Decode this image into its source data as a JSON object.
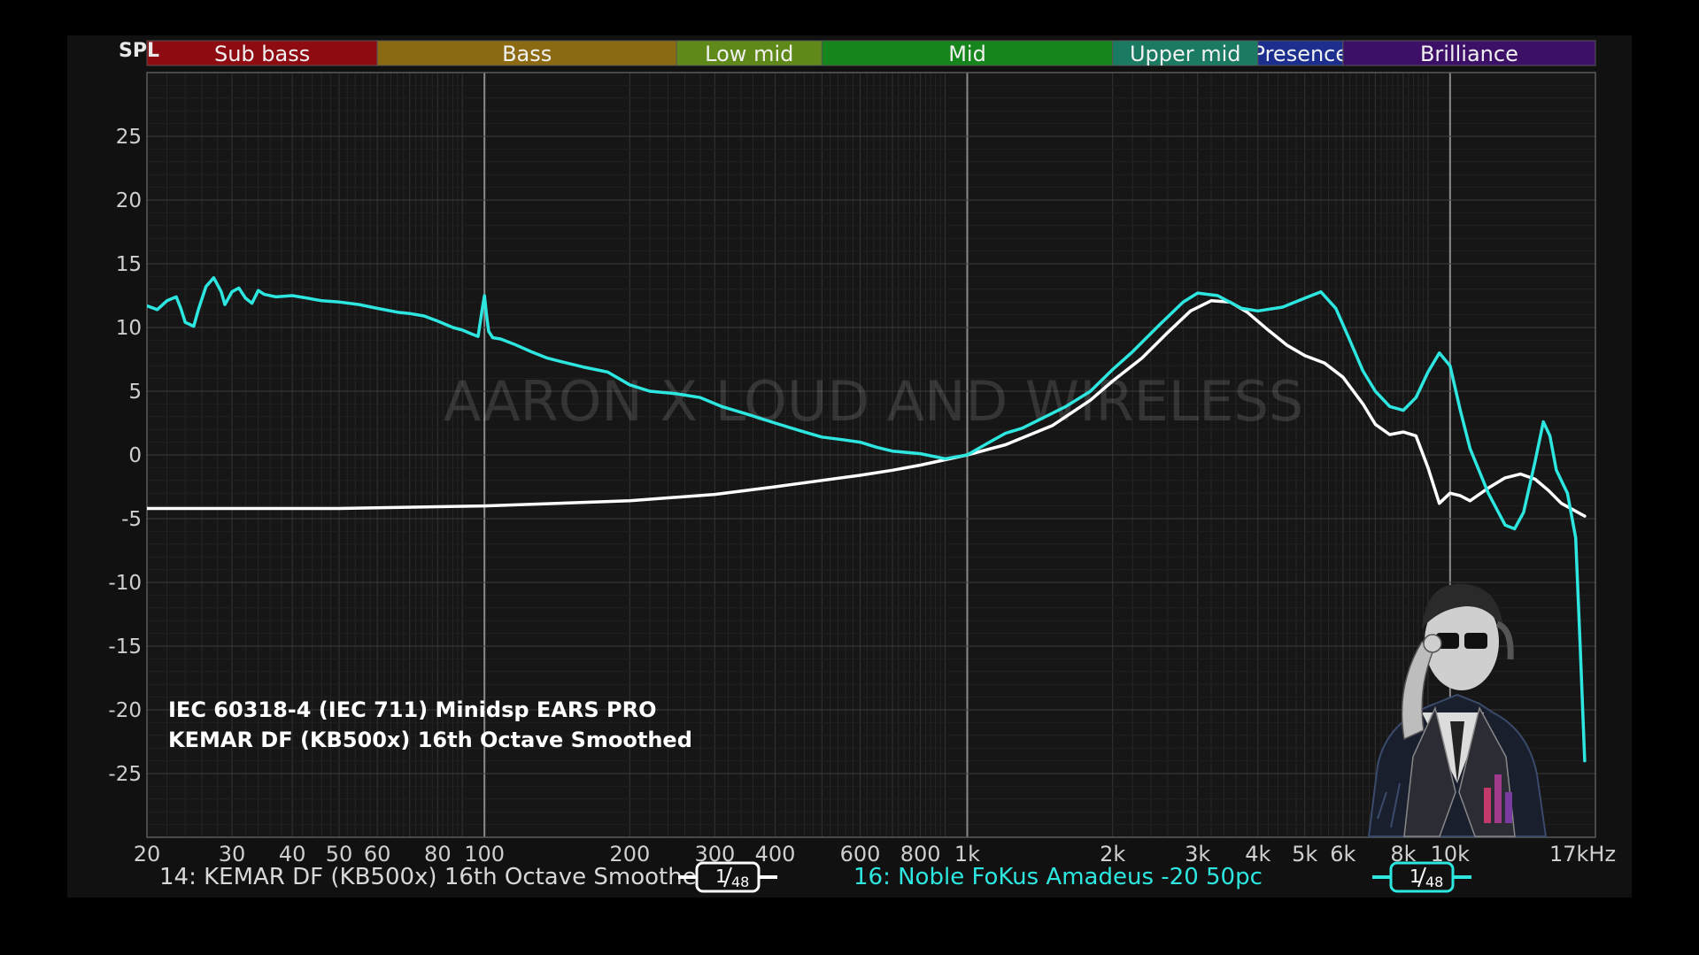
{
  "axis": {
    "y_label": "SPL",
    "x_unit_label": "kHz"
  },
  "bands": [
    {
      "label": "Sub bass",
      "from": 20,
      "to": 60,
      "color": "#8e0b12"
    },
    {
      "label": "Bass",
      "from": 60,
      "to": 250,
      "color": "#8c6a12"
    },
    {
      "label": "Low mid",
      "from": 250,
      "to": 500,
      "color": "#5f8a1a"
    },
    {
      "label": "Mid",
      "from": 500,
      "to": 2000,
      "color": "#15851c"
    },
    {
      "label": "Upper mid",
      "from": 2000,
      "to": 4000,
      "color": "#1a7a62"
    },
    {
      "label": "Presence",
      "from": 4000,
      "to": 6000,
      "color": "#1c2f8e"
    },
    {
      "label": "Brilliance",
      "from": 6000,
      "to": 20000,
      "color": "#3d1068"
    }
  ],
  "watermark": "AARON X LOUD AND WIRELESS",
  "notes": [
    "IEC 60318-4 (IEC 711) Minidsp EARS PRO",
    "KEMAR DF (KB500x) 16th Octave Smoothed"
  ],
  "legend": [
    {
      "label": "14: KEMAR DF (KB500x) 16th Octave Smoothed",
      "color": "#ffffff",
      "smoothing_num": "1",
      "smoothing_den": "48"
    },
    {
      "label": "16: Noble FoKus Amadeus -20 50pc",
      "color": "#2ee6e0",
      "smoothing_num": "1",
      "smoothing_den": "48"
    }
  ],
  "chart_data": {
    "type": "line",
    "xscale": "log",
    "xlim": [
      20,
      20000
    ],
    "ylim": [
      -30,
      30
    ],
    "grid": true,
    "xlabel": "",
    "ylabel": "SPL",
    "x_ticks": [
      {
        "v": 20,
        "t": "20"
      },
      {
        "v": 30,
        "t": "30"
      },
      {
        "v": 40,
        "t": "40"
      },
      {
        "v": 50,
        "t": "50"
      },
      {
        "v": 60,
        "t": "60"
      },
      {
        "v": 80,
        "t": "80"
      },
      {
        "v": 100,
        "t": "100"
      },
      {
        "v": 200,
        "t": "200"
      },
      {
        "v": 300,
        "t": "300"
      },
      {
        "v": 400,
        "t": "400"
      },
      {
        "v": 600,
        "t": "600"
      },
      {
        "v": 800,
        "t": "800"
      },
      {
        "v": 1000,
        "t": "1k"
      },
      {
        "v": 2000,
        "t": "2k"
      },
      {
        "v": 3000,
        "t": "3k"
      },
      {
        "v": 4000,
        "t": "4k"
      },
      {
        "v": 5000,
        "t": "5k"
      },
      {
        "v": 6000,
        "t": "6k"
      },
      {
        "v": 8000,
        "t": "8k"
      },
      {
        "v": 10000,
        "t": "10k"
      },
      {
        "v": 17000,
        "t": "17kHz"
      }
    ],
    "y_ticks": [
      {
        "v": 25,
        "t": "25"
      },
      {
        "v": 20,
        "t": "20"
      },
      {
        "v": 15,
        "t": "15"
      },
      {
        "v": 10,
        "t": "10"
      },
      {
        "v": 5,
        "t": "5"
      },
      {
        "v": 0,
        "t": "0"
      },
      {
        "v": -5,
        "t": "-5"
      },
      {
        "v": -10,
        "t": "-10"
      },
      {
        "v": -15,
        "t": "-15"
      },
      {
        "v": -20,
        "t": "-20"
      },
      {
        "v": -25,
        "t": "-25"
      }
    ],
    "series": [
      {
        "name": "14: KEMAR DF (KB500x) 16th Octave Smoothed",
        "color": "#ffffff",
        "points": [
          [
            20,
            -4.2
          ],
          [
            50,
            -4.2
          ],
          [
            100,
            -4.0
          ],
          [
            200,
            -3.6
          ],
          [
            300,
            -3.1
          ],
          [
            400,
            -2.5
          ],
          [
            500,
            -2.0
          ],
          [
            600,
            -1.6
          ],
          [
            700,
            -1.2
          ],
          [
            800,
            -0.8
          ],
          [
            1000,
            0.0
          ],
          [
            1200,
            0.8
          ],
          [
            1500,
            2.3
          ],
          [
            1800,
            4.3
          ],
          [
            2000,
            5.8
          ],
          [
            2300,
            7.6
          ],
          [
            2600,
            9.6
          ],
          [
            2900,
            11.3
          ],
          [
            3200,
            12.1
          ],
          [
            3500,
            12.0
          ],
          [
            3800,
            11.2
          ],
          [
            4200,
            9.8
          ],
          [
            4600,
            8.6
          ],
          [
            5000,
            7.8
          ],
          [
            5500,
            7.2
          ],
          [
            6000,
            6.1
          ],
          [
            6600,
            4.0
          ],
          [
            7000,
            2.4
          ],
          [
            7500,
            1.6
          ],
          [
            8000,
            1.8
          ],
          [
            8500,
            1.5
          ],
          [
            9000,
            -1.0
          ],
          [
            9500,
            -3.8
          ],
          [
            10000,
            -3.0
          ],
          [
            10500,
            -3.2
          ],
          [
            11000,
            -3.6
          ],
          [
            12000,
            -2.6
          ],
          [
            13000,
            -1.8
          ],
          [
            14000,
            -1.5
          ],
          [
            15000,
            -1.9
          ],
          [
            16000,
            -2.8
          ],
          [
            17000,
            -3.8
          ],
          [
            19000,
            -4.8
          ]
        ]
      },
      {
        "name": "16: Noble FoKus Amadeus -20 50pc",
        "color": "#2ee6e0",
        "points": [
          [
            20,
            11.7
          ],
          [
            21,
            11.4
          ],
          [
            22,
            12.1
          ],
          [
            23,
            12.4
          ],
          [
            23.5,
            11.5
          ],
          [
            24,
            10.4
          ],
          [
            25,
            10.1
          ],
          [
            25.6,
            11.5
          ],
          [
            26.5,
            13.2
          ],
          [
            27.5,
            13.9
          ],
          [
            28.5,
            12.8
          ],
          [
            29,
            11.8
          ],
          [
            30,
            12.8
          ],
          [
            31,
            13.1
          ],
          [
            32,
            12.3
          ],
          [
            33,
            11.9
          ],
          [
            34,
            12.9
          ],
          [
            35,
            12.6
          ],
          [
            37,
            12.4
          ],
          [
            40,
            12.5
          ],
          [
            43,
            12.3
          ],
          [
            46,
            12.1
          ],
          [
            50,
            12.0
          ],
          [
            55,
            11.8
          ],
          [
            60,
            11.5
          ],
          [
            66,
            11.2
          ],
          [
            70,
            11.1
          ],
          [
            75,
            10.9
          ],
          [
            80,
            10.5
          ],
          [
            86,
            10.0
          ],
          [
            90,
            9.8
          ],
          [
            94,
            9.5
          ],
          [
            97,
            9.3
          ],
          [
            99,
            11.5
          ],
          [
            100,
            12.5
          ],
          [
            101,
            11.0
          ],
          [
            102,
            9.7
          ],
          [
            104,
            9.2
          ],
          [
            108,
            9.1
          ],
          [
            115,
            8.7
          ],
          [
            125,
            8.1
          ],
          [
            135,
            7.6
          ],
          [
            145,
            7.3
          ],
          [
            160,
            6.9
          ],
          [
            180,
            6.5
          ],
          [
            200,
            5.5
          ],
          [
            220,
            5.0
          ],
          [
            250,
            4.8
          ],
          [
            280,
            4.5
          ],
          [
            310,
            3.8
          ],
          [
            350,
            3.2
          ],
          [
            400,
            2.5
          ],
          [
            450,
            1.9
          ],
          [
            500,
            1.4
          ],
          [
            550,
            1.2
          ],
          [
            600,
            1.0
          ],
          [
            650,
            0.6
          ],
          [
            700,
            0.3
          ],
          [
            800,
            0.1
          ],
          [
            900,
            -0.3
          ],
          [
            1000,
            0.0
          ],
          [
            1100,
            0.9
          ],
          [
            1200,
            1.7
          ],
          [
            1300,
            2.1
          ],
          [
            1400,
            2.7
          ],
          [
            1600,
            3.8
          ],
          [
            1800,
            5.0
          ],
          [
            2000,
            6.7
          ],
          [
            2200,
            8.1
          ],
          [
            2500,
            10.2
          ],
          [
            2800,
            12.0
          ],
          [
            3000,
            12.7
          ],
          [
            3300,
            12.5
          ],
          [
            3700,
            11.5
          ],
          [
            4000,
            11.3
          ],
          [
            4500,
            11.6
          ],
          [
            5000,
            12.3
          ],
          [
            5400,
            12.8
          ],
          [
            5800,
            11.5
          ],
          [
            6200,
            9.0
          ],
          [
            6600,
            6.6
          ],
          [
            7000,
            5.0
          ],
          [
            7500,
            3.8
          ],
          [
            8000,
            3.5
          ],
          [
            8500,
            4.5
          ],
          [
            9000,
            6.5
          ],
          [
            9500,
            8.0
          ],
          [
            10000,
            7.0
          ],
          [
            10500,
            3.5
          ],
          [
            11000,
            0.5
          ],
          [
            12000,
            -3.0
          ],
          [
            13000,
            -5.5
          ],
          [
            13600,
            -5.8
          ],
          [
            14200,
            -4.5
          ],
          [
            15000,
            -0.5
          ],
          [
            15600,
            2.6
          ],
          [
            16100,
            1.5
          ],
          [
            16600,
            -1.2
          ],
          [
            17500,
            -3.0
          ],
          [
            18200,
            -6.5
          ],
          [
            18600,
            -15.0
          ],
          [
            19000,
            -24.0
          ]
        ]
      }
    ]
  }
}
